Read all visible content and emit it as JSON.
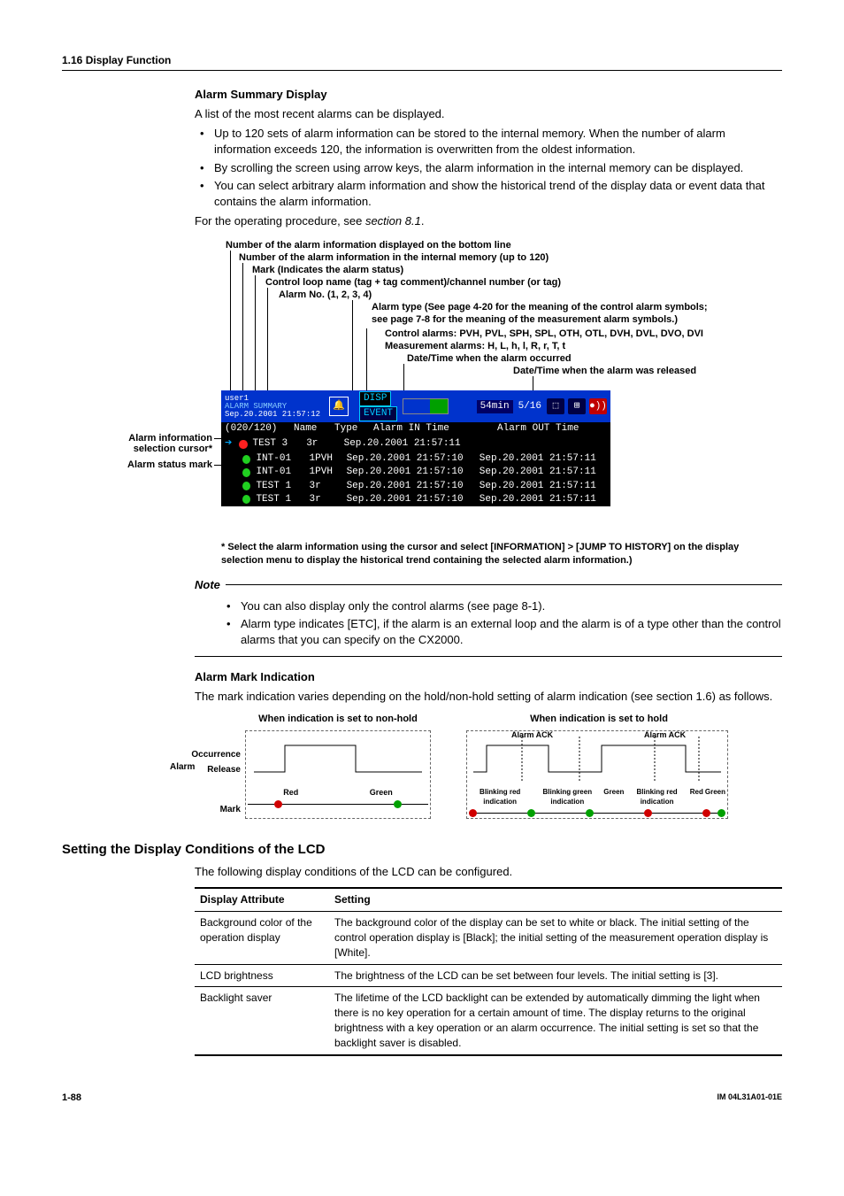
{
  "header": {
    "section": "1.16  Display Function"
  },
  "alarm_summary": {
    "heading": "Alarm Summary Display",
    "intro": "A list of the most recent alarms can be displayed.",
    "bullets": [
      "Up to 120 sets of alarm information can be stored to the internal memory.  When the number of alarm information exceeds 120, the information is overwritten from the oldest information.",
      "By scrolling the screen using arrow keys, the alarm information in the internal memory can be displayed.",
      "You can select arbitrary alarm information and show the historical trend of the display data or event data that contains the alarm information."
    ],
    "procedure_prefix": "For the operating procedure, see ",
    "procedure_link": "section 8.1",
    "procedure_suffix": "."
  },
  "diagram_labels": {
    "l1": "Number of the alarm information displayed on the bottom line",
    "l2": "Number of the alarm information in the internal memory (up to 120)",
    "l3": "Mark (Indicates the alarm status)",
    "l4": "Control loop name (tag + tag comment)/channel number (or tag)",
    "l5": "Alarm No. (1, 2, 3, 4)",
    "l6": "Alarm type (See page 4-20 for the meaning of the control alarm symbols; see page 7-8 for the meaning of the measurement alarm symbols.)",
    "l7": "Control alarms: PVH, PVL, SPH, SPL, OTH, OTL, DVH, DVL, DVO, DVI",
    "l8": "Measurement alarms: H, L, h, l, R, r, T, t",
    "l9": "Date/Time when the alarm occurred",
    "l10": "Date/Time when the alarm was released"
  },
  "left_callouts": {
    "c1": "Alarm information selection cursor*",
    "c2": "Alarm status mark"
  },
  "screenshot": {
    "user": "user1",
    "title": "ALARM SUMMARY",
    "stamp": "Sep.20.2001 21:57:12",
    "disp": "DISP",
    "event": "EVENT",
    "time_ind": "54min",
    "page_ind": "5/16",
    "count": "(020/120)",
    "cols": {
      "name": "Name",
      "type": "Type",
      "in": "Alarm IN Time",
      "out": "Alarm OUT Time"
    },
    "rows": [
      {
        "dot": "red",
        "cursor": true,
        "name": "TEST 3",
        "type": "3r",
        "in": "Sep.20.2001 21:57:11",
        "out": ""
      },
      {
        "dot": "green",
        "cursor": false,
        "name": "INT-01",
        "type": "1PVH",
        "in": "Sep.20.2001 21:57:10",
        "out": "Sep.20.2001 21:57:11"
      },
      {
        "dot": "green",
        "cursor": false,
        "name": "INT-01",
        "type": "1PVH",
        "in": "Sep.20.2001 21:57:10",
        "out": "Sep.20.2001 21:57:11"
      },
      {
        "dot": "green",
        "cursor": false,
        "name": "TEST 1",
        "type": "3r",
        "in": "Sep.20.2001 21:57:10",
        "out": "Sep.20.2001 21:57:11"
      },
      {
        "dot": "green",
        "cursor": false,
        "name": "TEST 1",
        "type": "3r",
        "in": "Sep.20.2001 21:57:10",
        "out": "Sep.20.2001 21:57:11"
      }
    ]
  },
  "footnote": "* Select the alarm information using the cursor and select [INFORMATION] > [JUMP TO HISTORY] on the display selection menu to display the historical trend containing the selected alarm information.)",
  "note": {
    "head": "Note",
    "bullets": [
      "You can also display only the control alarms (see page 8-1).",
      "Alarm type indicates [ETC], if the alarm is an external loop and the alarm is of a type other than the control alarms that you can specify on the CX2000."
    ]
  },
  "alarm_mark": {
    "heading": "Alarm Mark Indication",
    "body": "The mark indication varies depending on the hold/non-hold setting of alarm indication (see section 1.6) as follows.",
    "col1_title": "When indication is set to non-hold",
    "col2_title": "When indication is set to hold",
    "axis": {
      "alarm": "Alarm",
      "occurrence": "Occurrence",
      "release": "Release",
      "mark": "Mark"
    },
    "states_nonhold": [
      "Red",
      "Green"
    ],
    "states_hold_labels": [
      "Blinking red indication",
      "Blinking green indication",
      "Green",
      "Blinking red indication",
      "Red",
      "Green"
    ],
    "ack": "Alarm ACK"
  },
  "lcd_section": {
    "heading": "Setting the Display Conditions of the LCD",
    "intro": "The following display conditions of the LCD can be configured.",
    "table": {
      "headers": [
        "Display Attribute",
        "Setting"
      ],
      "rows": [
        {
          "attr": "Background color of the operation display",
          "setting": "The background color of the display can be set to white or black.  The initial setting of the control operation display is [Black]; the initial setting of the measurement operation display is [White]."
        },
        {
          "attr": "LCD brightness",
          "setting": "The brightness of the LCD can be set between four levels.  The initial setting is [3]."
        },
        {
          "attr": "Backlight saver",
          "setting": "The lifetime of the LCD backlight can be extended by automatically dimming the light when there is no key operation for a certain amount of time.  The display returns to the original brightness with a key operation or an alarm occurrence.  The initial setting is set so that the backlight saver is disabled."
        }
      ]
    }
  },
  "footer": {
    "page": "1-88",
    "doc": "IM 04L31A01-01E"
  }
}
